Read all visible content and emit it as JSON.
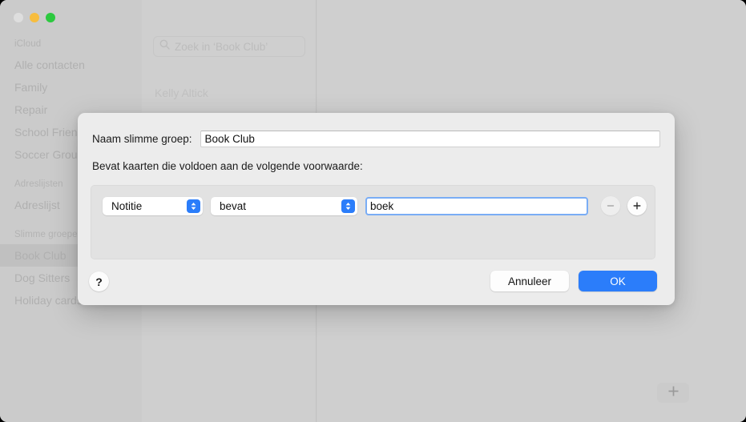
{
  "window": {
    "traffic_lights": [
      {
        "name": "close",
        "color": "#dedede"
      },
      {
        "name": "minimize",
        "color": "#f7bd3f"
      },
      {
        "name": "maximize",
        "color": "#2cc93f"
      }
    ]
  },
  "sidebar": {
    "sections": [
      {
        "header": "iCloud",
        "items": [
          {
            "label": "Alle contacten",
            "selected": false
          },
          {
            "label": "Family",
            "selected": false
          },
          {
            "label": "Repair",
            "selected": false
          },
          {
            "label": "School Friends",
            "selected": false
          },
          {
            "label": "Soccer Group",
            "selected": false
          }
        ]
      },
      {
        "header": "Adreslijsten",
        "items": [
          {
            "label": "Adreslijst",
            "selected": false
          }
        ]
      },
      {
        "header": "Slimme groepen",
        "items": [
          {
            "label": "Book Club",
            "selected": true
          },
          {
            "label": "Dog Sitters",
            "selected": false
          },
          {
            "label": "Holiday cards",
            "selected": false
          }
        ]
      }
    ]
  },
  "list_column": {
    "search": {
      "icon": "search-icon",
      "placeholder": "Zoek in ‘Book Club’",
      "value": ""
    },
    "contacts": [
      {
        "name": "Kelly Altick"
      }
    ]
  },
  "detail_column": {
    "add_button_label": "+"
  },
  "dialog": {
    "name_label": "Naam slimme groep:",
    "name_value": "Book Club",
    "condition_label": "Bevat kaarten die voldoen aan de volgende voorwaarde:",
    "condition": {
      "attribute": "Notitie",
      "operator": "bevat",
      "value": "boek",
      "remove_label": "−",
      "add_label": "+"
    },
    "help_label": "?",
    "cancel_label": "Annuleer",
    "ok_label": "OK"
  },
  "colors": {
    "accent": "#2b7dfa",
    "focus_ring": "#7aadf5",
    "window_bg": "#cccccc",
    "dialog_bg": "#ececec",
    "groupbox_bg": "#e2e2e2"
  }
}
